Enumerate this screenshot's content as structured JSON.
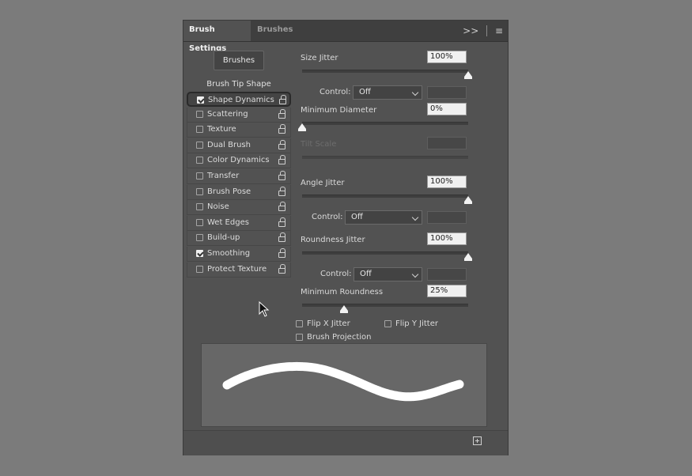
{
  "tabs": {
    "active": "Brush Settings",
    "inactive": "Brushes",
    "collapse": ">>",
    "menu": "≡"
  },
  "brushes_button": "Brushes",
  "sidebar": {
    "tip_shape": "Brush Tip Shape",
    "items": [
      {
        "label": "Shape Dynamics",
        "checked": true,
        "selected": true
      },
      {
        "label": "Scattering",
        "checked": false
      },
      {
        "label": "Texture",
        "checked": false
      },
      {
        "label": "Dual Brush",
        "checked": false
      },
      {
        "label": "Color Dynamics",
        "checked": false
      },
      {
        "label": "Transfer",
        "checked": false
      },
      {
        "label": "Brush Pose",
        "checked": false
      },
      {
        "label": "Noise",
        "checked": false
      },
      {
        "label": "Wet Edges",
        "checked": false
      },
      {
        "label": "Build-up",
        "checked": false
      },
      {
        "label": "Smoothing",
        "checked": true
      },
      {
        "label": "Protect Texture",
        "checked": false
      }
    ]
  },
  "settings": {
    "size_jitter": {
      "label": "Size Jitter",
      "value": "100%",
      "level": 1.0
    },
    "control1": {
      "label": "Control:",
      "value": "Off"
    },
    "min_diameter": {
      "label": "Minimum Diameter",
      "value": "0%",
      "level": 0.0
    },
    "tilt_scale": {
      "label": "Tilt Scale",
      "value": ""
    },
    "angle_jitter": {
      "label": "Angle Jitter",
      "value": "100%",
      "level": 1.0
    },
    "control2": {
      "label": "Control:",
      "value": "Off"
    },
    "roundness_jitter": {
      "label": "Roundness Jitter",
      "value": "100%",
      "level": 1.0
    },
    "control3": {
      "label": "Control:",
      "value": "Off"
    },
    "min_roundness": {
      "label": "Minimum Roundness",
      "value": "25%",
      "level": 0.25
    },
    "flip_x": {
      "label": "Flip X Jitter",
      "checked": false
    },
    "flip_y": {
      "label": "Flip Y Jitter",
      "checked": false
    },
    "brush_projection": {
      "label": "Brush Projection",
      "checked": false
    }
  },
  "icons": {
    "lock": "lock-icon",
    "new_preset": "new-preset-icon",
    "cursor": "arrow-cursor-icon"
  }
}
